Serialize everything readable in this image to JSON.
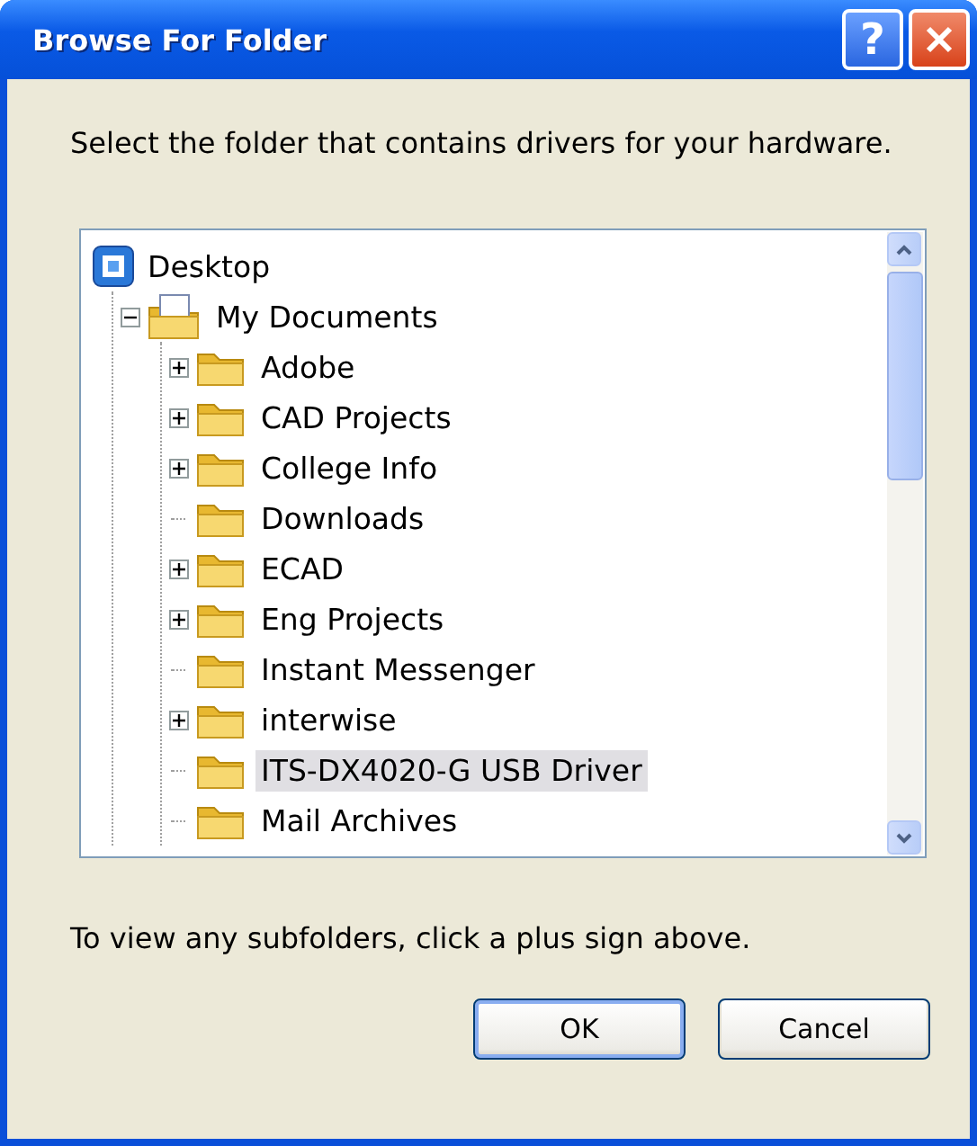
{
  "window": {
    "title": "Browse For Folder",
    "help_glyph": "?"
  },
  "instruction": "Select the folder that contains drivers for your hardware.",
  "tree": [
    {
      "label": "Desktop",
      "kind": "desktop",
      "selected": false,
      "children": [
        {
          "label": "My Documents",
          "kind": "documents",
          "expanded": true,
          "selected": false,
          "children": [
            {
              "label": "Adobe",
              "kind": "folder",
              "expanded": false,
              "selected": false
            },
            {
              "label": "CAD Projects",
              "kind": "folder",
              "expanded": false,
              "selected": false
            },
            {
              "label": "College Info",
              "kind": "folder",
              "expanded": false,
              "selected": false
            },
            {
              "label": "Downloads",
              "kind": "folder",
              "selected": false
            },
            {
              "label": "ECAD",
              "kind": "folder",
              "expanded": false,
              "selected": false
            },
            {
              "label": "Eng Projects",
              "kind": "folder",
              "expanded": false,
              "selected": false
            },
            {
              "label": "Instant Messenger",
              "kind": "folder",
              "selected": false
            },
            {
              "label": "interwise",
              "kind": "folder",
              "expanded": false,
              "selected": false
            },
            {
              "label": "ITS-DX4020-G USB Driver",
              "kind": "folder",
              "selected": true
            },
            {
              "label": "Mail Archives",
              "kind": "folder",
              "selected": false
            }
          ]
        }
      ]
    }
  ],
  "hint": "To view any subfolders, click a plus sign above.",
  "buttons": [
    {
      "label": "OK",
      "default": true
    },
    {
      "label": "Cancel",
      "default": false
    }
  ]
}
